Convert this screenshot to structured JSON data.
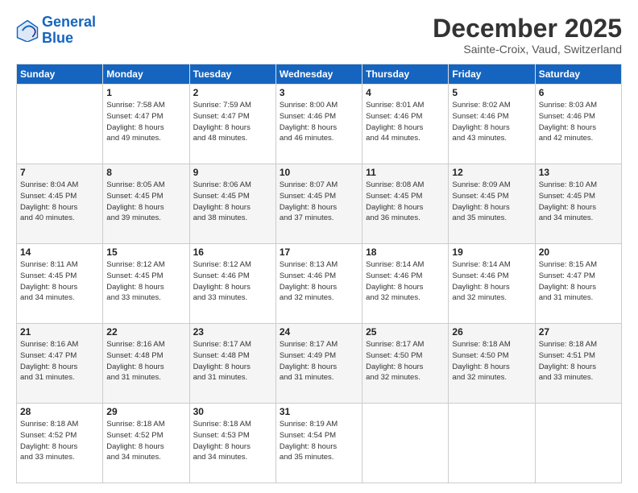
{
  "logo": {
    "line1": "General",
    "line2": "Blue"
  },
  "header": {
    "month_title": "December 2025",
    "location": "Sainte-Croix, Vaud, Switzerland"
  },
  "weekdays": [
    "Sunday",
    "Monday",
    "Tuesday",
    "Wednesday",
    "Thursday",
    "Friday",
    "Saturday"
  ],
  "weeks": [
    [
      {
        "day": "",
        "sunrise": "",
        "sunset": "",
        "daylight": ""
      },
      {
        "day": "1",
        "sunrise": "Sunrise: 7:58 AM",
        "sunset": "Sunset: 4:47 PM",
        "daylight": "Daylight: 8 hours and 49 minutes."
      },
      {
        "day": "2",
        "sunrise": "Sunrise: 7:59 AM",
        "sunset": "Sunset: 4:47 PM",
        "daylight": "Daylight: 8 hours and 48 minutes."
      },
      {
        "day": "3",
        "sunrise": "Sunrise: 8:00 AM",
        "sunset": "Sunset: 4:46 PM",
        "daylight": "Daylight: 8 hours and 46 minutes."
      },
      {
        "day": "4",
        "sunrise": "Sunrise: 8:01 AM",
        "sunset": "Sunset: 4:46 PM",
        "daylight": "Daylight: 8 hours and 44 minutes."
      },
      {
        "day": "5",
        "sunrise": "Sunrise: 8:02 AM",
        "sunset": "Sunset: 4:46 PM",
        "daylight": "Daylight: 8 hours and 43 minutes."
      },
      {
        "day": "6",
        "sunrise": "Sunrise: 8:03 AM",
        "sunset": "Sunset: 4:46 PM",
        "daylight": "Daylight: 8 hours and 42 minutes."
      }
    ],
    [
      {
        "day": "7",
        "sunrise": "Sunrise: 8:04 AM",
        "sunset": "Sunset: 4:45 PM",
        "daylight": "Daylight: 8 hours and 40 minutes."
      },
      {
        "day": "8",
        "sunrise": "Sunrise: 8:05 AM",
        "sunset": "Sunset: 4:45 PM",
        "daylight": "Daylight: 8 hours and 39 minutes."
      },
      {
        "day": "9",
        "sunrise": "Sunrise: 8:06 AM",
        "sunset": "Sunset: 4:45 PM",
        "daylight": "Daylight: 8 hours and 38 minutes."
      },
      {
        "day": "10",
        "sunrise": "Sunrise: 8:07 AM",
        "sunset": "Sunset: 4:45 PM",
        "daylight": "Daylight: 8 hours and 37 minutes."
      },
      {
        "day": "11",
        "sunrise": "Sunrise: 8:08 AM",
        "sunset": "Sunset: 4:45 PM",
        "daylight": "Daylight: 8 hours and 36 minutes."
      },
      {
        "day": "12",
        "sunrise": "Sunrise: 8:09 AM",
        "sunset": "Sunset: 4:45 PM",
        "daylight": "Daylight: 8 hours and 35 minutes."
      },
      {
        "day": "13",
        "sunrise": "Sunrise: 8:10 AM",
        "sunset": "Sunset: 4:45 PM",
        "daylight": "Daylight: 8 hours and 34 minutes."
      }
    ],
    [
      {
        "day": "14",
        "sunrise": "Sunrise: 8:11 AM",
        "sunset": "Sunset: 4:45 PM",
        "daylight": "Daylight: 8 hours and 34 minutes."
      },
      {
        "day": "15",
        "sunrise": "Sunrise: 8:12 AM",
        "sunset": "Sunset: 4:45 PM",
        "daylight": "Daylight: 8 hours and 33 minutes."
      },
      {
        "day": "16",
        "sunrise": "Sunrise: 8:12 AM",
        "sunset": "Sunset: 4:46 PM",
        "daylight": "Daylight: 8 hours and 33 minutes."
      },
      {
        "day": "17",
        "sunrise": "Sunrise: 8:13 AM",
        "sunset": "Sunset: 4:46 PM",
        "daylight": "Daylight: 8 hours and 32 minutes."
      },
      {
        "day": "18",
        "sunrise": "Sunrise: 8:14 AM",
        "sunset": "Sunset: 4:46 PM",
        "daylight": "Daylight: 8 hours and 32 minutes."
      },
      {
        "day": "19",
        "sunrise": "Sunrise: 8:14 AM",
        "sunset": "Sunset: 4:46 PM",
        "daylight": "Daylight: 8 hours and 32 minutes."
      },
      {
        "day": "20",
        "sunrise": "Sunrise: 8:15 AM",
        "sunset": "Sunset: 4:47 PM",
        "daylight": "Daylight: 8 hours and 31 minutes."
      }
    ],
    [
      {
        "day": "21",
        "sunrise": "Sunrise: 8:16 AM",
        "sunset": "Sunset: 4:47 PM",
        "daylight": "Daylight: 8 hours and 31 minutes."
      },
      {
        "day": "22",
        "sunrise": "Sunrise: 8:16 AM",
        "sunset": "Sunset: 4:48 PM",
        "daylight": "Daylight: 8 hours and 31 minutes."
      },
      {
        "day": "23",
        "sunrise": "Sunrise: 8:17 AM",
        "sunset": "Sunset: 4:48 PM",
        "daylight": "Daylight: 8 hours and 31 minutes."
      },
      {
        "day": "24",
        "sunrise": "Sunrise: 8:17 AM",
        "sunset": "Sunset: 4:49 PM",
        "daylight": "Daylight: 8 hours and 31 minutes."
      },
      {
        "day": "25",
        "sunrise": "Sunrise: 8:17 AM",
        "sunset": "Sunset: 4:50 PM",
        "daylight": "Daylight: 8 hours and 32 minutes."
      },
      {
        "day": "26",
        "sunrise": "Sunrise: 8:18 AM",
        "sunset": "Sunset: 4:50 PM",
        "daylight": "Daylight: 8 hours and 32 minutes."
      },
      {
        "day": "27",
        "sunrise": "Sunrise: 8:18 AM",
        "sunset": "Sunset: 4:51 PM",
        "daylight": "Daylight: 8 hours and 33 minutes."
      }
    ],
    [
      {
        "day": "28",
        "sunrise": "Sunrise: 8:18 AM",
        "sunset": "Sunset: 4:52 PM",
        "daylight": "Daylight: 8 hours and 33 minutes."
      },
      {
        "day": "29",
        "sunrise": "Sunrise: 8:18 AM",
        "sunset": "Sunset: 4:52 PM",
        "daylight": "Daylight: 8 hours and 34 minutes."
      },
      {
        "day": "30",
        "sunrise": "Sunrise: 8:18 AM",
        "sunset": "Sunset: 4:53 PM",
        "daylight": "Daylight: 8 hours and 34 minutes."
      },
      {
        "day": "31",
        "sunrise": "Sunrise: 8:19 AM",
        "sunset": "Sunset: 4:54 PM",
        "daylight": "Daylight: 8 hours and 35 minutes."
      },
      {
        "day": "",
        "sunrise": "",
        "sunset": "",
        "daylight": ""
      },
      {
        "day": "",
        "sunrise": "",
        "sunset": "",
        "daylight": ""
      },
      {
        "day": "",
        "sunrise": "",
        "sunset": "",
        "daylight": ""
      }
    ]
  ]
}
